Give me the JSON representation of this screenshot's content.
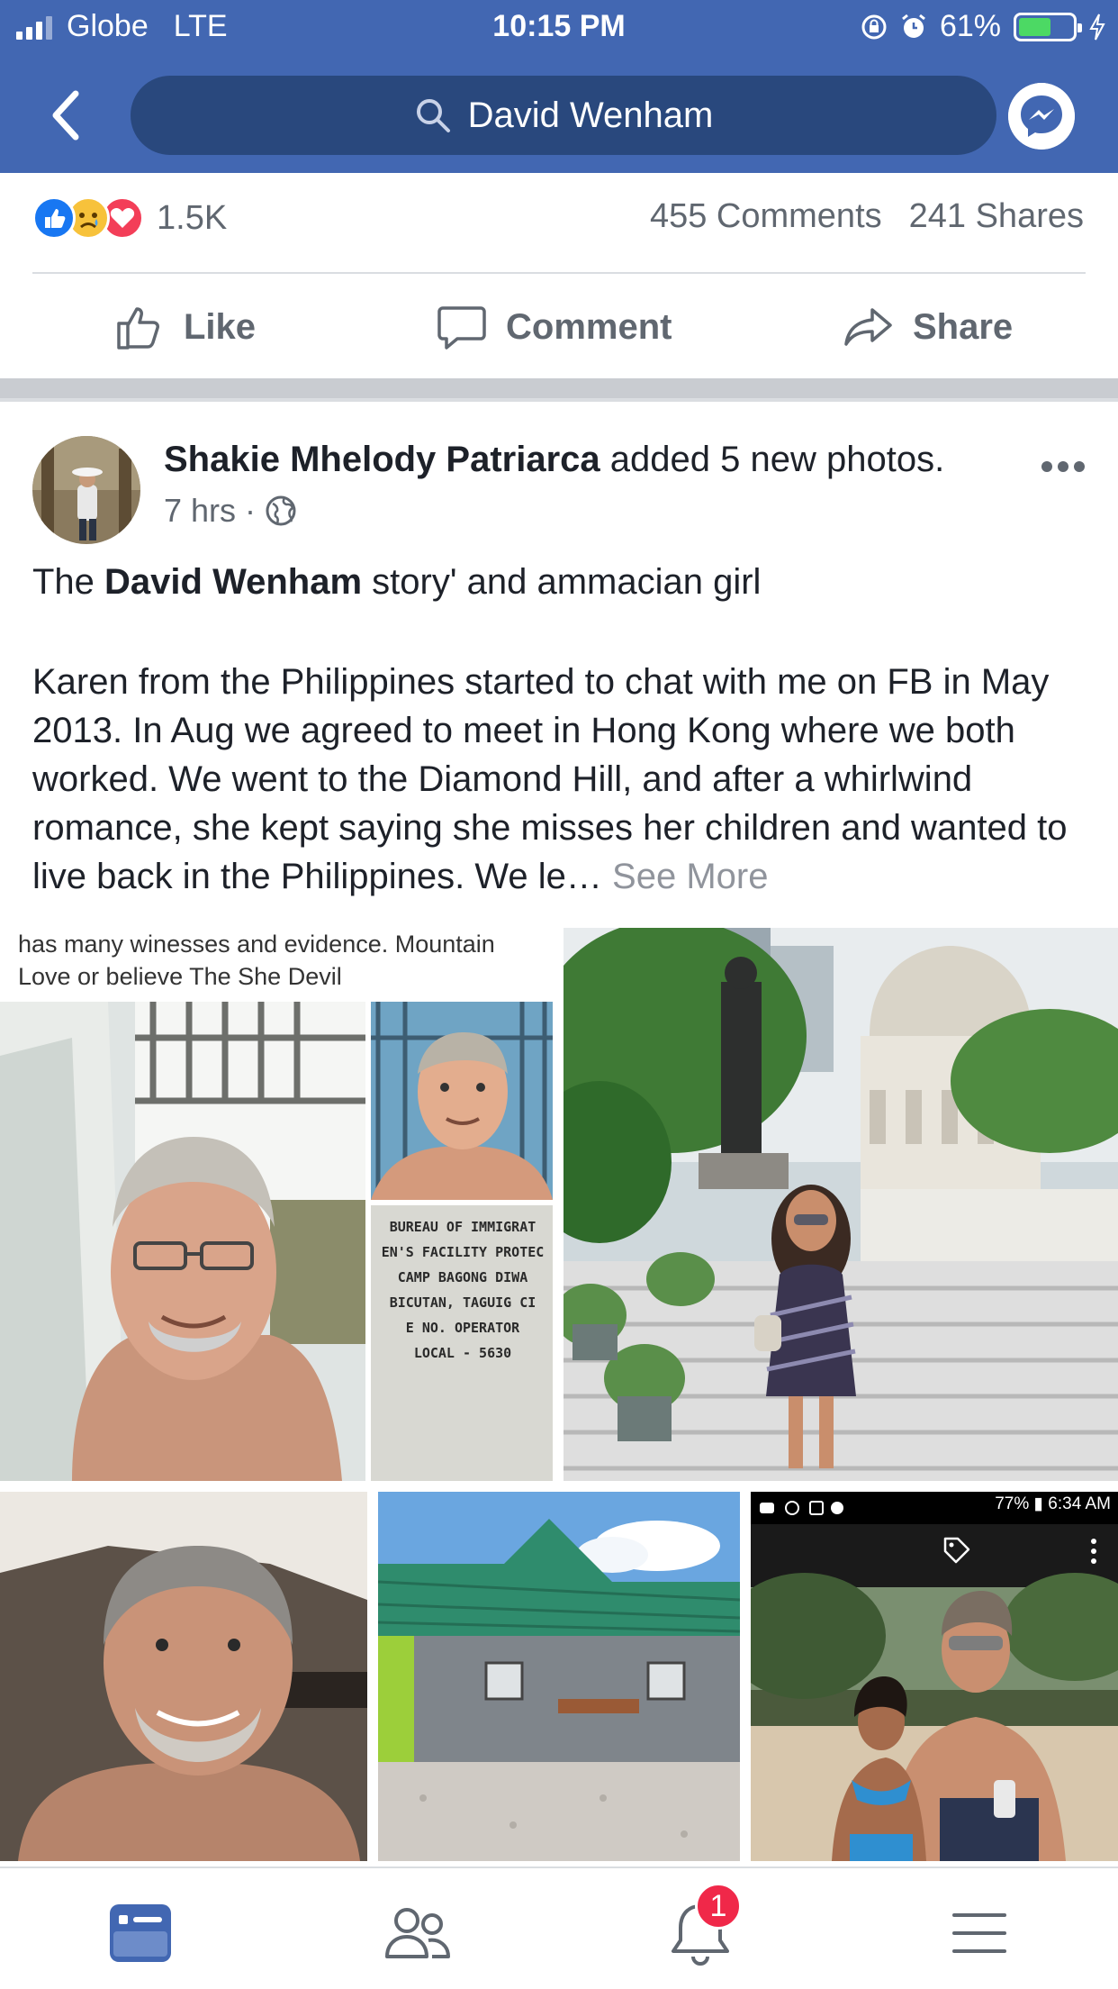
{
  "status_bar": {
    "carrier": "Globe",
    "network": "LTE",
    "time": "10:15 PM",
    "battery": "61%",
    "battery_level": 0.61
  },
  "header": {
    "search_text": "David Wenham"
  },
  "reaction_bar": {
    "reaction_icons": [
      "like-icon",
      "sad-icon",
      "love-icon"
    ],
    "reaction_count": "1.5K",
    "comments": "455 Comments",
    "shares": "241 Shares"
  },
  "actions": {
    "like": "Like",
    "comment": "Comment",
    "share": "Share"
  },
  "post": {
    "author": "Shakie Mhelody Patriarca",
    "action_text": " added 5 new photos.",
    "time": "7 hrs",
    "privacy_icon": "globe-icon",
    "title_prefix": "The ",
    "title_bold": "David Wenham",
    "title_suffix": " story' and ammacian girl",
    "body": "Karen from the Philippines started to chat with me on FB in May 2013. In Aug we agreed to meet in Hong Kong where we both worked. We went to the Diamond Hill, and after a whirlwind romance, she kept saying she misses her children and wanted to live back in the Philippines. We le…",
    "see_more": " See More"
  },
  "photos": {
    "collage_caption_line1": "has many winesses and evidence. Mountain",
    "collage_caption_line2": "Love or believe The She Devil",
    "document_lines": [
      "BUREAU OF IMMIGRAT",
      "EN'S FACILITY PROTEC",
      "CAMP BAGONG DIWA",
      "BICUTAN, TAGUIG CI",
      "E NO. OPERATOR",
      "LOCAL - 5630"
    ],
    "phone_status": "77% ▮ 6:34 AM"
  },
  "tab_bar": {
    "items": [
      "news-feed-icon",
      "friends-icon",
      "notifications-icon",
      "menu-icon"
    ],
    "notification_badge": "1"
  },
  "colors": {
    "facebook_blue": "#4267b2",
    "search_bg": "#29487d",
    "secondary_text": "#606770",
    "badge_red": "#f02849"
  }
}
